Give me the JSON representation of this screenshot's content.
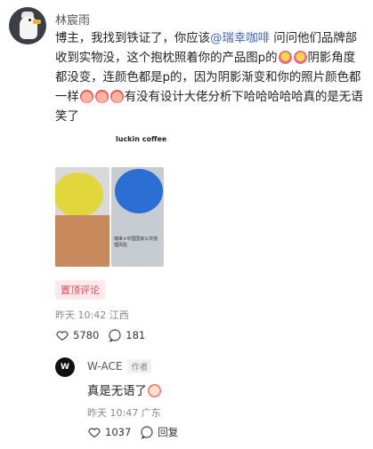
{
  "comment": {
    "username": "林宸雨",
    "text_parts": {
      "p1": "博主，我找到铁证了，你应该",
      "mention": "@瑞幸咖啡",
      "p2": " 问问他们品牌部收到实物没，这个抱枕照着你的产品图p的",
      "p3": "阴影角度都没变，连颜色都是p的，因为阴影渐变和你的照片颜色都一样",
      "p4": "有没有设计大佬分析下哈哈哈哈哈真的是无语笑了"
    },
    "image_caption": "luckin coffee",
    "image_label": "瑞幸×中国国家公共管理风险",
    "pin_badge": "置顶评论",
    "time": "昨天 10:42",
    "location": "江西",
    "likes": "5780",
    "replies": "181"
  },
  "reply": {
    "avatar_text": "W",
    "username": "W-ACE",
    "author_tag": "作者",
    "text": "真是无语了",
    "time": "昨天 10:47",
    "location": "广东",
    "likes": "1037",
    "reply_label": "回复"
  },
  "icons": [
    "heart-icon",
    "comment-icon",
    "emoji-rich-icon",
    "emoji-laugh-icon",
    "emoji-clown-icon"
  ],
  "colors": {
    "mention": "#3a63c9",
    "badge_bg": "#fde8ea",
    "badge_text": "#e94c5f"
  }
}
